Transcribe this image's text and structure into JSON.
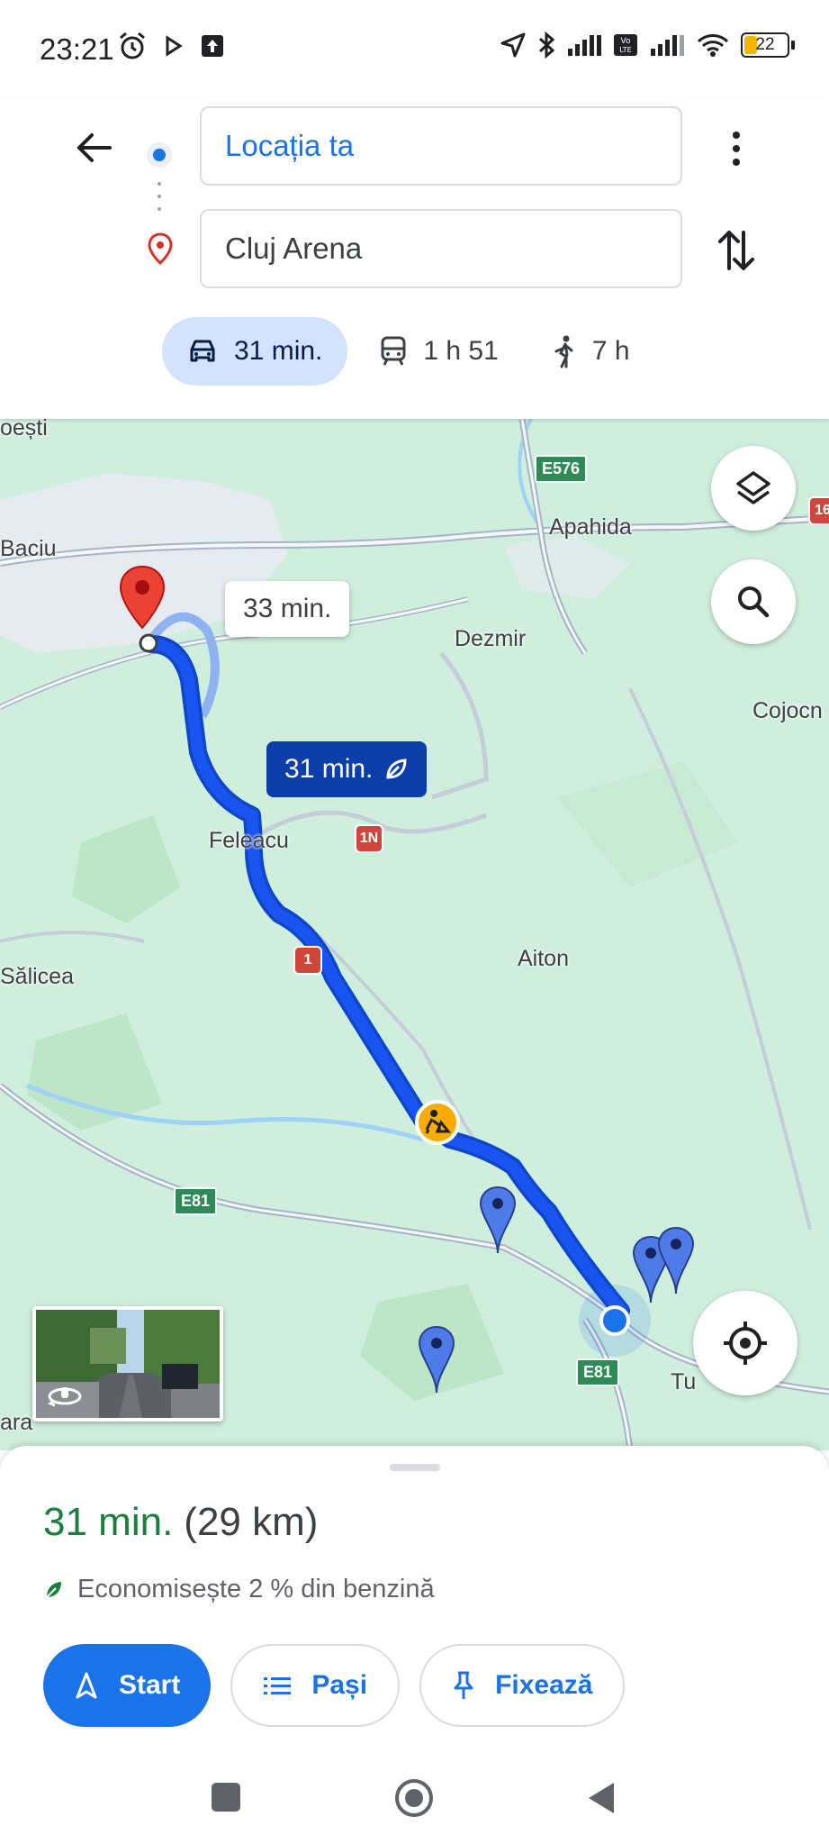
{
  "status_bar": {
    "time": "23:21",
    "battery": "22",
    "icons_left": [
      "alarm-icon",
      "play-icon",
      "upload-icon"
    ],
    "icons_right": [
      "location-arrow-icon",
      "bluetooth-icon",
      "signal-icon",
      "volte-icon",
      "signal-icon",
      "wifi-icon",
      "battery-icon"
    ]
  },
  "directions": {
    "origin": "Locația ta",
    "destination": "Cluj Arena",
    "modes": [
      {
        "icon": "car-icon",
        "label": "31 min.",
        "active": true
      },
      {
        "icon": "train-icon",
        "label": "1 h 51",
        "active": false
      },
      {
        "icon": "walk-icon",
        "label": "7 h",
        "active": false
      }
    ]
  },
  "map": {
    "places": [
      "oești",
      "Baciu",
      "Apahida",
      "Dezmir",
      "Cojocn",
      "Feleacu",
      "Aiton",
      "Sălicea",
      "ara",
      "Tu"
    ],
    "shields": {
      "e576": "E576",
      "e81_a": "E81",
      "e81_b": "E81",
      "r1n": "1N",
      "r1": "1",
      "r16": "16"
    },
    "alt_route_time": "33 min.",
    "main_route_time": "31 min."
  },
  "sheet": {
    "duration": "31 min.",
    "distance": "(29 km)",
    "eco_note": "Economisește 2 % din benzină",
    "start_label": "Start",
    "steps_label": "Pași",
    "pin_label": "Fixează"
  },
  "colors": {
    "accent": "#1a73e8",
    "route": "#1a54f0",
    "duration_green": "#188038",
    "map_bg": "#cfeedd"
  }
}
